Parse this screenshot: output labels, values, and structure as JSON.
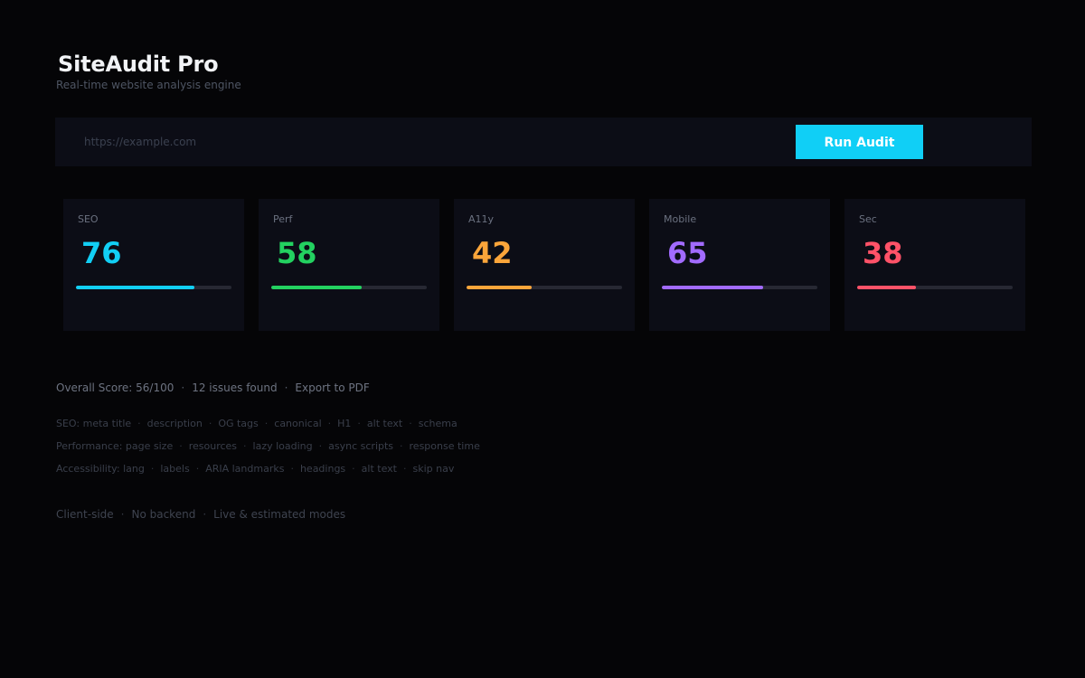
{
  "header": {
    "title": "SiteAudit Pro",
    "subtitle": "Real-time website analysis engine"
  },
  "audit_form": {
    "url_placeholder": "https://example.com",
    "url_value": "",
    "run_button_label": "Run Audit"
  },
  "score_cards": [
    {
      "id": "seo",
      "label": "SEO",
      "score": "76",
      "fill_percent": 76,
      "color": "#12cff5"
    },
    {
      "id": "perf",
      "label": "Perf",
      "score": "58",
      "fill_percent": 58,
      "color": "#23d160"
    },
    {
      "id": "a11y",
      "label": "A11y",
      "score": "42",
      "fill_percent": 42,
      "color": "#fba53a"
    },
    {
      "id": "mobile",
      "label": "Mobile",
      "score": "65",
      "fill_percent": 65,
      "color": "#a26bff"
    },
    {
      "id": "sec",
      "label": "Sec",
      "score": "38",
      "fill_percent": 38,
      "color": "#ff5268"
    }
  ],
  "summary": {
    "overall_score": "Overall Score: 56/100",
    "issues": "12 issues found",
    "export_label": "Export to PDF"
  },
  "check_groups": [
    [
      "SEO: meta title",
      "description",
      "OG tags",
      "canonical",
      "H1",
      "alt text",
      "schema"
    ],
    [
      "Performance: page size",
      "resources",
      "lazy loading",
      "async scripts",
      "response time"
    ],
    [
      "Accessibility: lang",
      "labels",
      "ARIA landmarks",
      "headings",
      "alt text",
      "skip nav"
    ]
  ],
  "footer": [
    "Client-side",
    "No backend",
    "Live & estimated modes"
  ],
  "separator": "·"
}
